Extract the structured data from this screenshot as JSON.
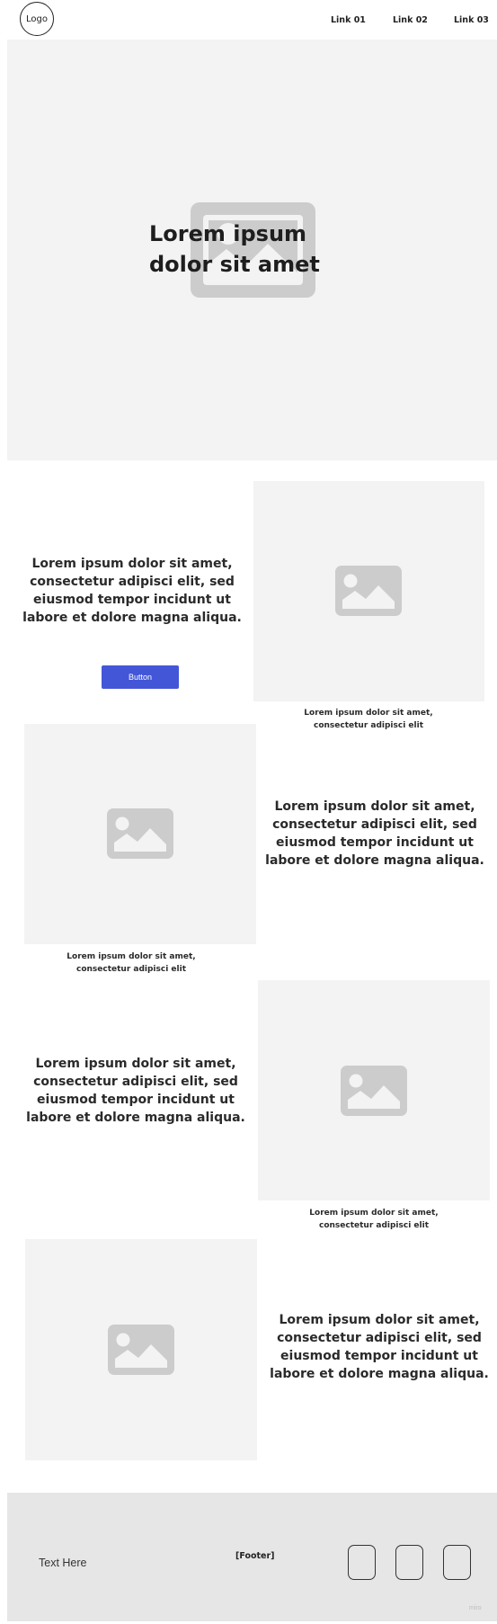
{
  "header": {
    "logo_label": "Logo",
    "nav_links": [
      "Link 01",
      "Link 02",
      "Link 03"
    ]
  },
  "hero": {
    "title": "Lorem ipsum dolor sit amet",
    "image_icon": "image-placeholder-icon"
  },
  "sections": [
    {
      "text": "Lorem ipsum dolor sit amet, consectetur adipisci elit, sed eiusmod tempor incidunt ut labore et dolore magna aliqua.",
      "button_label": "Button",
      "caption": "Lorem ipsum dolor sit amet, consectetur adipisci elit"
    },
    {
      "text": "Lorem ipsum dolor sit amet, consectetur adipisci elit, sed eiusmod tempor incidunt ut labore et dolore magna aliqua.",
      "caption": "Lorem ipsum dolor sit amet, consectetur adipisci elit"
    },
    {
      "text": "Lorem ipsum dolor sit amet, consectetur adipisci elit, sed eiusmod tempor incidunt ut labore et dolore magna aliqua.",
      "caption": "Lorem ipsum dolor sit amet, consectetur adipisci elit"
    },
    {
      "text": "Lorem ipsum dolor sit amet, consectetur adipisci elit, sed eiusmod tempor incidunt ut labore et dolore magna aliqua."
    }
  ],
  "footer": {
    "text": "Text Here",
    "label": "[Footer]",
    "social_icons": [
      "social-icon-1",
      "social-icon-2",
      "social-icon-3"
    ],
    "watermark": "miro"
  },
  "colors": {
    "button": "#4356d8",
    "placeholder_bg": "#f3f3f3",
    "placeholder_icon": "#cccccc",
    "footer_bg": "#e6e6e6"
  }
}
